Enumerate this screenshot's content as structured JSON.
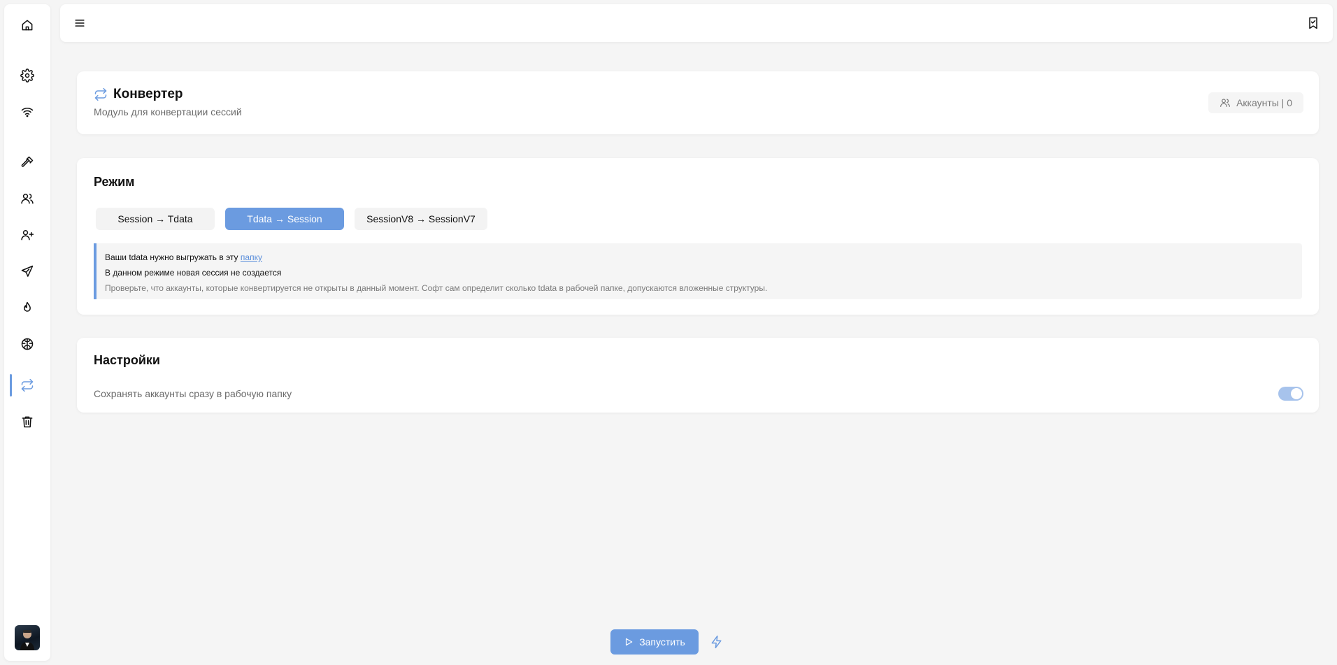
{
  "header": {
    "title": "Конвертер",
    "subtitle": "Модуль для конвертации сессий",
    "accounts_label": "Аккаунты | 0"
  },
  "mode": {
    "title": "Режим",
    "tabs": [
      {
        "label": "Session → Tdata",
        "active": false
      },
      {
        "label": "Tdata → Session",
        "active": true
      },
      {
        "label": "SessionV8 → SessionV7",
        "active": false
      }
    ],
    "info": {
      "line1_text": "Ваши tdata нужно выгружать в эту ",
      "line1_link": "папку",
      "line2": "В данном режиме новая сессия не создается",
      "line3": "Проверьте, что аккаунты, которые конвертируется не открыты в данный момент. Софт сам определит сколько tdata в рабочей папке, допускаются вложенные структуры."
    }
  },
  "settings": {
    "title": "Настройки",
    "save_to_workdir_label": "Сохранять аккаунты сразу в рабочую папку",
    "save_to_workdir_enabled": true
  },
  "actions": {
    "run_label": "Запустить"
  },
  "sidebar": {
    "items": [
      "home-icon",
      "gear-icon",
      "wifi-icon",
      "hammer-icon",
      "users-icon",
      "user-plus-icon",
      "send-icon",
      "flame-icon",
      "brain-icon",
      "convert-icon",
      "trash-icon"
    ],
    "active": "convert-icon"
  },
  "colors": {
    "accent": "#6b9be0",
    "background": "#f5f5f5",
    "toggle_on": "#a7c3ec"
  }
}
